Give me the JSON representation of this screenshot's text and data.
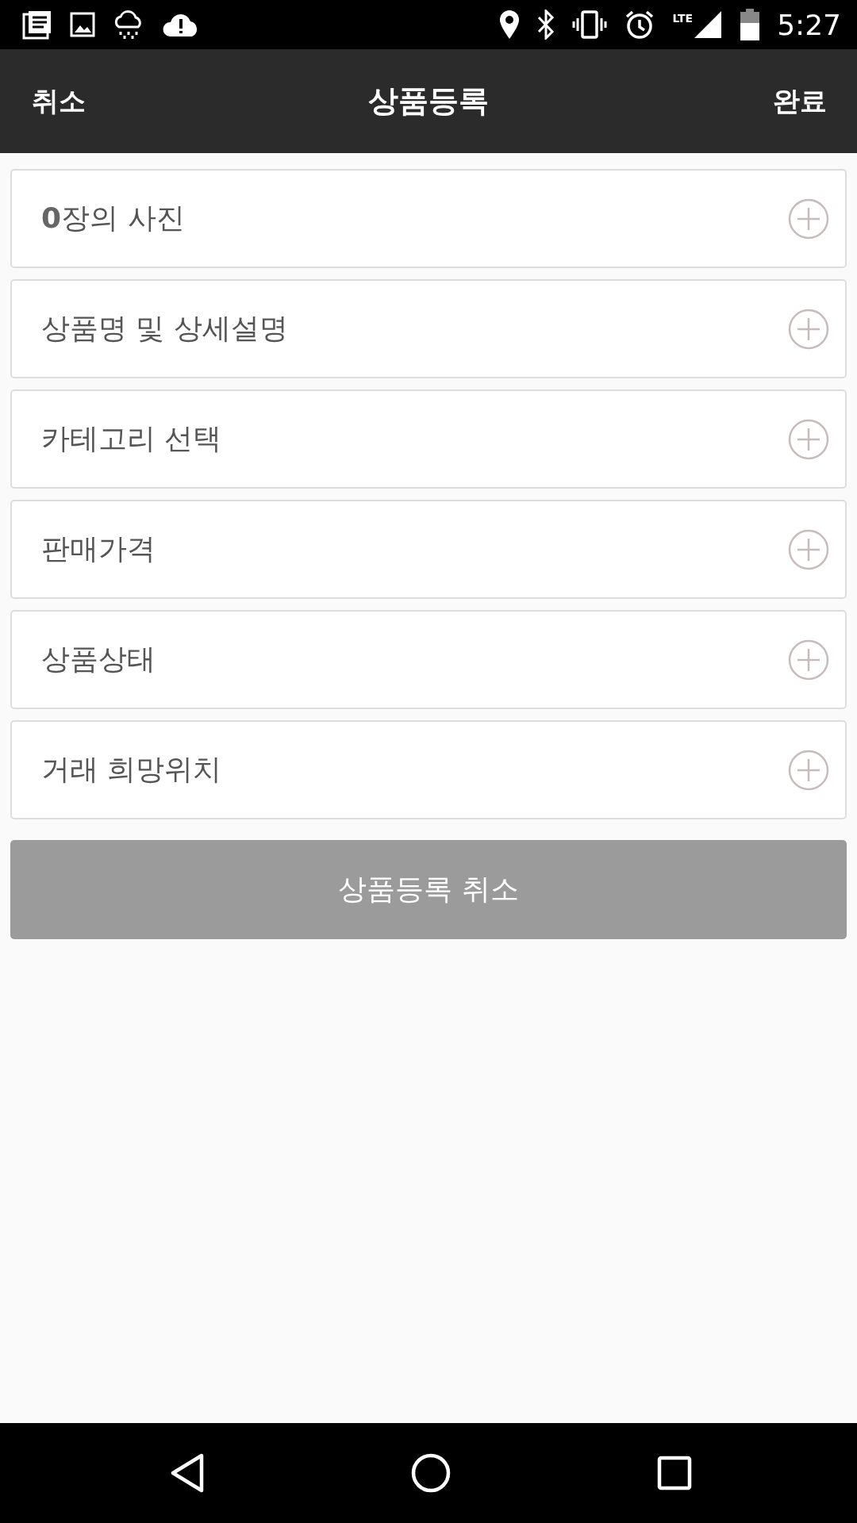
{
  "status_bar": {
    "network": "LTE",
    "time": "5:27"
  },
  "header": {
    "left": "취소",
    "title": "상품등록",
    "right": "완료"
  },
  "rows": [
    {
      "label": "**0**장의 사진"
    },
    {
      "label": "상품명 및 상세설명"
    },
    {
      "label": "카테고리 선택"
    },
    {
      "label": "판매가격"
    },
    {
      "label": "상품상태"
    },
    {
      "label": "거래 희망위치"
    }
  ],
  "cancel_button": "상품등록 취소"
}
